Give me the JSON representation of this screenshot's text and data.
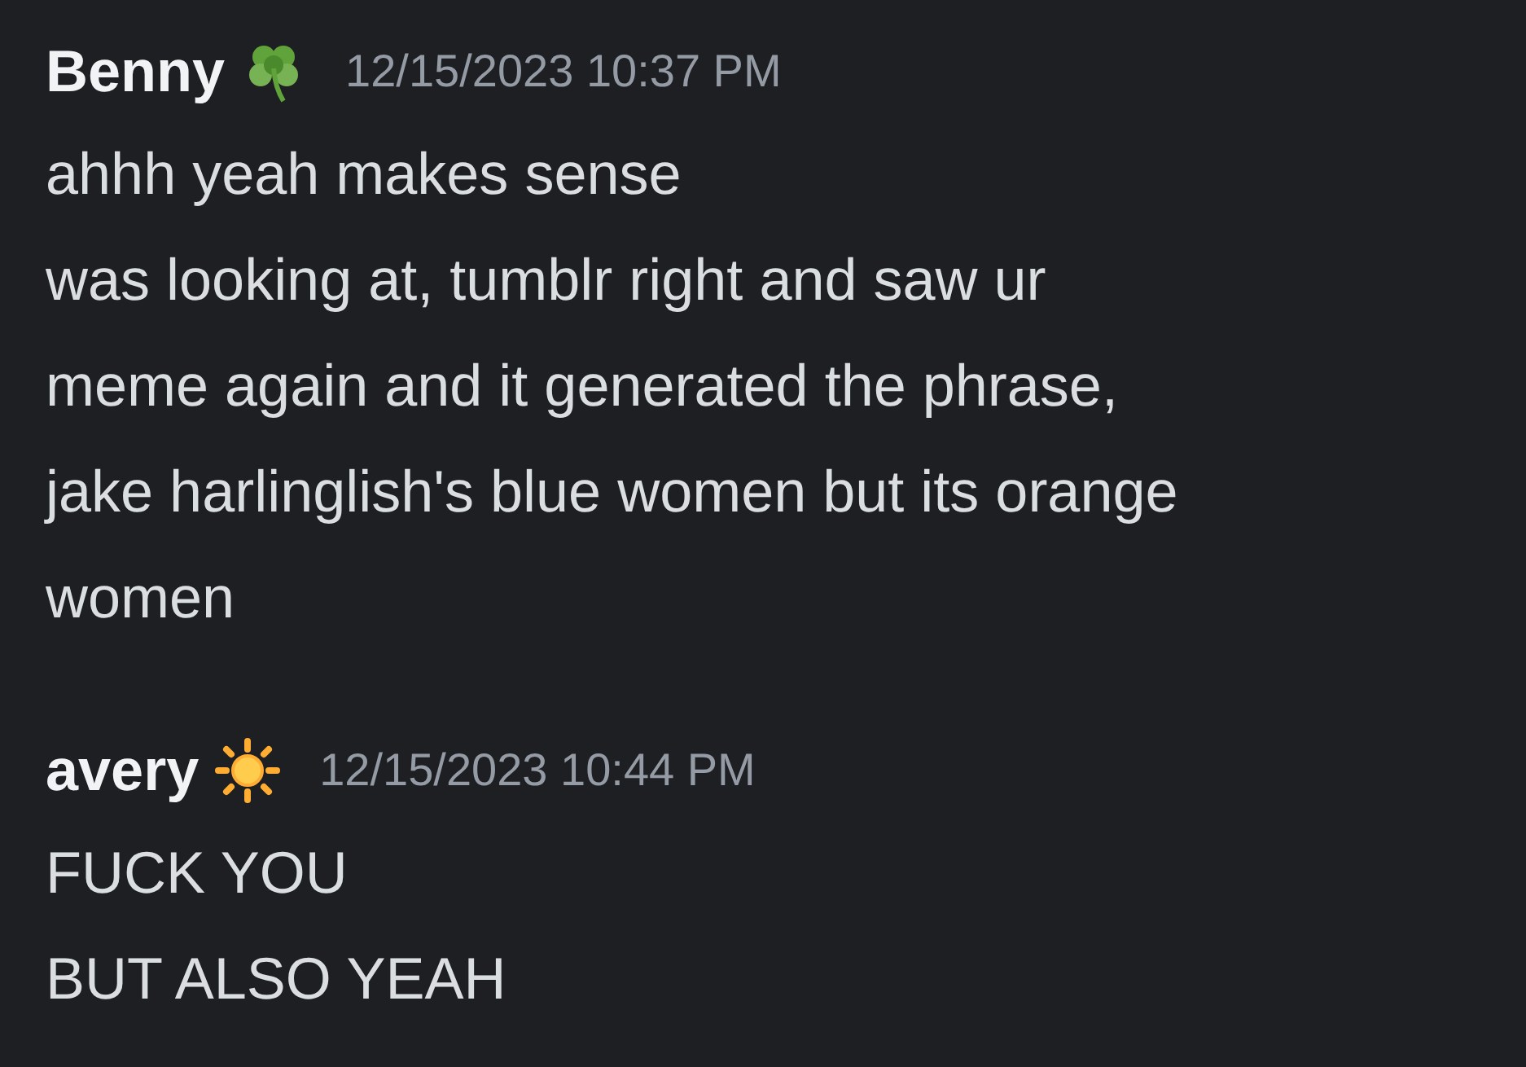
{
  "messages": [
    {
      "author": "Benny",
      "badge": {
        "kind": "clover"
      },
      "timestamp": "12/15/2023 10:37 PM",
      "lines": [
        "ahhh yeah makes sense",
        "was looking at, tumblr right and saw ur meme again and it generated the phrase, jake harlinglish's blue women but its orange women"
      ]
    },
    {
      "author": "avery",
      "badge": {
        "kind": "sun"
      },
      "timestamp": "12/15/2023 10:44 PM",
      "lines": [
        "FUCK YOU",
        "BUT ALSO YEAH"
      ]
    }
  ]
}
